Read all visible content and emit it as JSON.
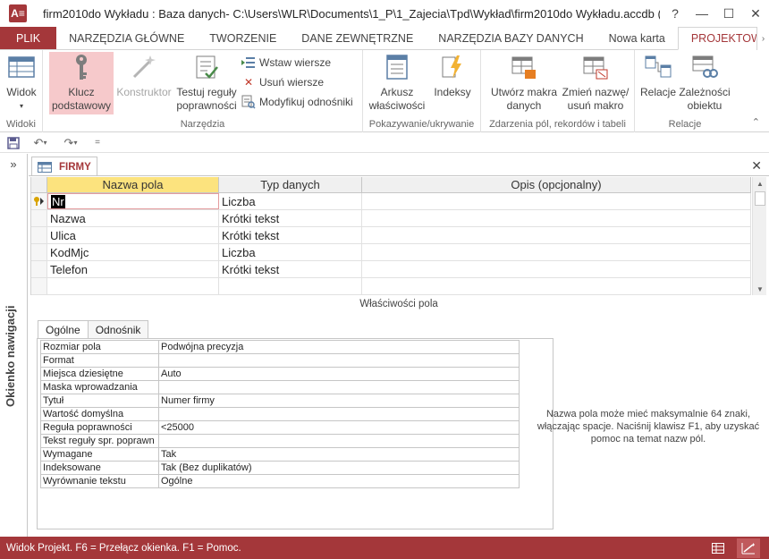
{
  "window": {
    "app_icon": "A≡",
    "title": "firm2010do Wykładu : Baza danych- C:\\Users\\WLR\\Documents\\1_P\\1_Zajecia\\Tpd\\Wykład\\firm2010do Wykładu.accdb (format...",
    "help": "?",
    "minimize": "—",
    "maximize": "☐",
    "close": "✕"
  },
  "tabs": [
    {
      "label": "PLIK"
    },
    {
      "label": "NARZĘDZIA GŁÓWNE"
    },
    {
      "label": "TWORZENIE"
    },
    {
      "label": "DANE ZEWNĘTRZNE"
    },
    {
      "label": "NARZĘDZIA BAZY DANYCH"
    },
    {
      "label": "Nowa karta"
    },
    {
      "label": "PROJEKTOWANIE"
    }
  ],
  "ribbon": {
    "widoki": {
      "label": "Widoki",
      "widok": "Widok"
    },
    "narzedzia": {
      "label": "Narzędzia",
      "klucz_line1": "Klucz",
      "klucz_line2": "podstawowy",
      "konstruktor": "Konstruktor",
      "testuj_line1": "Testuj reguły",
      "testuj_line2": "poprawności",
      "wstaw": "Wstaw wiersze",
      "usun": "Usuń wiersze",
      "modyfikuj": "Modyfikuj odnośniki"
    },
    "pokazywanie": {
      "label": "Pokazywanie/ukrywanie",
      "arkusz_line1": "Arkusz",
      "arkusz_line2": "właściwości",
      "indeksy": "Indeksy"
    },
    "zdarzenia": {
      "label": "Zdarzenia pól, rekordów i tabeli",
      "utworz_line1": "Utwórz makra",
      "utworz_line2": "danych",
      "zmien_line1": "Zmień nazwę/",
      "zmien_line2": "usuń makro"
    },
    "relacje": {
      "label": "Relacje",
      "relacje_btn": "Relacje",
      "zaleznosci_line1": "Zależności",
      "zaleznosci_line2": "obiektu"
    }
  },
  "qat": {
    "customize": "="
  },
  "nav": {
    "toggle": "»",
    "label": "Okienko nawigacji"
  },
  "document": {
    "tab_label": "FIRMY",
    "close": "✕",
    "columns": [
      "Nazwa pola",
      "Typ danych",
      "Opis (opcjonalny)"
    ],
    "fields": [
      {
        "name": "Nr",
        "type": "Liczba",
        "desc": ""
      },
      {
        "name": "Nazwa",
        "type": "Krótki tekst",
        "desc": ""
      },
      {
        "name": "Ulica",
        "type": "Krótki tekst",
        "desc": ""
      },
      {
        "name": "KodMjc",
        "type": "Liczba",
        "desc": ""
      },
      {
        "name": "Telefon",
        "type": "Krótki tekst",
        "desc": ""
      },
      {
        "name": "",
        "type": "",
        "desc": ""
      }
    ],
    "props_title": "Właściwości pola"
  },
  "properties": {
    "tab_general": "Ogólne",
    "tab_lookup": "Odnośnik",
    "rows": [
      {
        "label": "Rozmiar pola",
        "value": "Podwójna precyzja"
      },
      {
        "label": "Format",
        "value": ""
      },
      {
        "label": "Miejsca dziesiętne",
        "value": "Auto"
      },
      {
        "label": "Maska wprowadzania",
        "value": ""
      },
      {
        "label": "Tytuł",
        "value": "Numer firmy"
      },
      {
        "label": "Wartość domyślna",
        "value": ""
      },
      {
        "label": "Reguła poprawności",
        "value": "<25000"
      },
      {
        "label": "Tekst reguły spr. poprawn",
        "value": ""
      },
      {
        "label": "Wymagane",
        "value": "Tak"
      },
      {
        "label": "Indeksowane",
        "value": "Tak (Bez duplikatów)"
      },
      {
        "label": "Wyrównanie tekstu",
        "value": "Ogólne"
      }
    ],
    "help_text": "Nazwa pola może mieć maksymalnie 64 znaki, włączając spacje. Naciśnij klawisz F1, aby uzyskać pomoc na temat nazw pól."
  },
  "status": {
    "text": "Widok Projekt. F6 = Przełącz okienka. F1 = Pomoc."
  },
  "colors": {
    "accent": "#a4373a",
    "header_highlight": "#fce37e",
    "selected_button": "#f6c9cb"
  }
}
